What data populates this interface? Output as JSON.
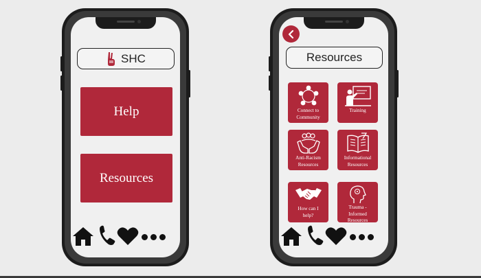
{
  "colors": {
    "accent": "#b0283a",
    "background": "#ececec",
    "screen": "#f0f0f0"
  },
  "home_screen": {
    "title": "SHC",
    "logo_icon": "peace-hand-icon",
    "buttons": [
      {
        "label": "Help"
      },
      {
        "label": "Resources"
      }
    ]
  },
  "resources_screen": {
    "back_icon": "chevron-left-icon",
    "title": "Resources",
    "tiles": [
      {
        "label": "Connect to\nCommunity",
        "icon": "community-network-icon"
      },
      {
        "label": "Training",
        "icon": "presentation-board-icon"
      },
      {
        "label": "Anti-Racism\nResources",
        "icon": "raised-hands-group-icon"
      },
      {
        "label": "Informational\nResources",
        "icon": "open-book-icon"
      },
      {
        "label": "How can I\nhelp?",
        "icon": "handshake-icon"
      },
      {
        "label": "Trauma -\nInformed\nResources",
        "icon": "head-mind-icon"
      }
    ]
  },
  "nav_icons": [
    "home-icon",
    "phone-icon",
    "heart-icon",
    "more-icon"
  ]
}
